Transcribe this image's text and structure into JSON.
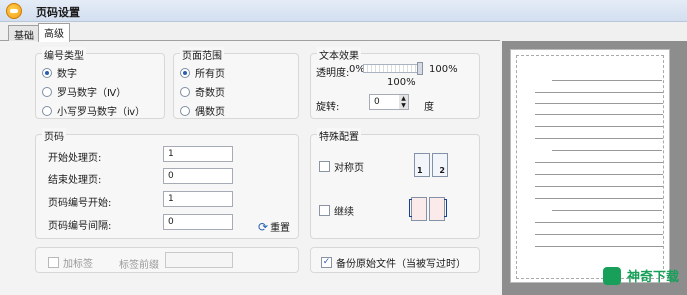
{
  "window": {
    "title": "页码设置"
  },
  "tabs": [
    {
      "label": "基础"
    },
    {
      "label": "高级"
    }
  ],
  "number_type": {
    "title": "编号类型",
    "options": [
      {
        "label": "数字",
        "selected": true
      },
      {
        "label": "罗马数字（Ⅳ）",
        "selected": false
      },
      {
        "label": "小写罗马数字（ⅳ）",
        "selected": false
      }
    ]
  },
  "page_range": {
    "title": "页面范围",
    "options": [
      {
        "label": "所有页",
        "selected": true
      },
      {
        "label": "奇数页",
        "selected": false
      },
      {
        "label": "偶数页",
        "selected": false
      }
    ]
  },
  "text_effect": {
    "title": "文本效果",
    "opacity_label": "透明度:",
    "opacity_min": "0%",
    "opacity_max": "100%",
    "opacity_value": "100%",
    "rotate_label": "旋转:",
    "rotate_value": "0",
    "rotate_unit": "度"
  },
  "page_number": {
    "title": "页码",
    "fields": [
      {
        "label": "开始处理页:",
        "value": "1"
      },
      {
        "label": "结束处理页:",
        "value": "0"
      },
      {
        "label": "页码编号开始:",
        "value": "1"
      },
      {
        "label": "页码编号间隔:",
        "value": "0"
      }
    ],
    "reset_label": "重置"
  },
  "special": {
    "title": "特殊配置",
    "symmetric_label": "对称页",
    "continue_label": "继续",
    "icon_pages": [
      "1",
      "2"
    ]
  },
  "bottom": {
    "add_label_text": "加标签",
    "label_prefix_text": "标签前缀",
    "label_prefix_value": "",
    "backup_text": "备份原始文件（当被写过时）",
    "backup_checked": true
  },
  "watermark": {
    "text": "神奇下载"
  },
  "colors": {
    "accent": "#2a5fb5",
    "watermark": "#18a05a"
  }
}
